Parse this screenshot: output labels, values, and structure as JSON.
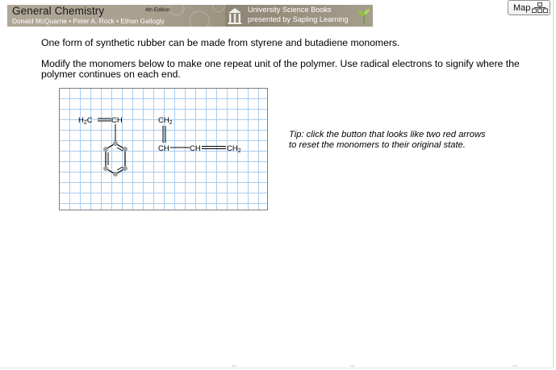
{
  "banner": {
    "book_title": "General Chemistry",
    "edition": "4th Edition",
    "authors": "Donald McQuarrie • Peter A. Rock • Ethan Gallogly",
    "publisher_line1": "University Science Books",
    "publisher_line2": "presented by Sapling Learning"
  },
  "map_button": {
    "label": "Map"
  },
  "question": {
    "line1": "One form of synthetic rubber can be made from styrene and butadiene monomers.",
    "line2": "Modify the monomers below to make one repeat unit of the polymer. Use radical electrons to signify where the polymer continues on each end."
  },
  "tip": {
    "line1": "Tip: click the button that looks like two red arrows",
    "line2": "to reset the monomers to their original state."
  },
  "drawing": {
    "styrene": {
      "left_label": "H",
      "left_sub": "2",
      "left_c": "C",
      "right_label": "CH"
    },
    "butadiene": {
      "top_label": "CH",
      "top_sub": "2",
      "mid_left": "CH",
      "mid_center": "CH",
      "right_label": "CH",
      "right_sub": "2"
    }
  },
  "colors": {
    "grid_line": "#a9ccec",
    "atom_marker": "#a0a0a0",
    "banner_bg": "#a89f8e"
  },
  "icons": {
    "map": "hierarchy-icon",
    "publisher": "columns-logo-icon",
    "sapling": "sprout-icon"
  }
}
